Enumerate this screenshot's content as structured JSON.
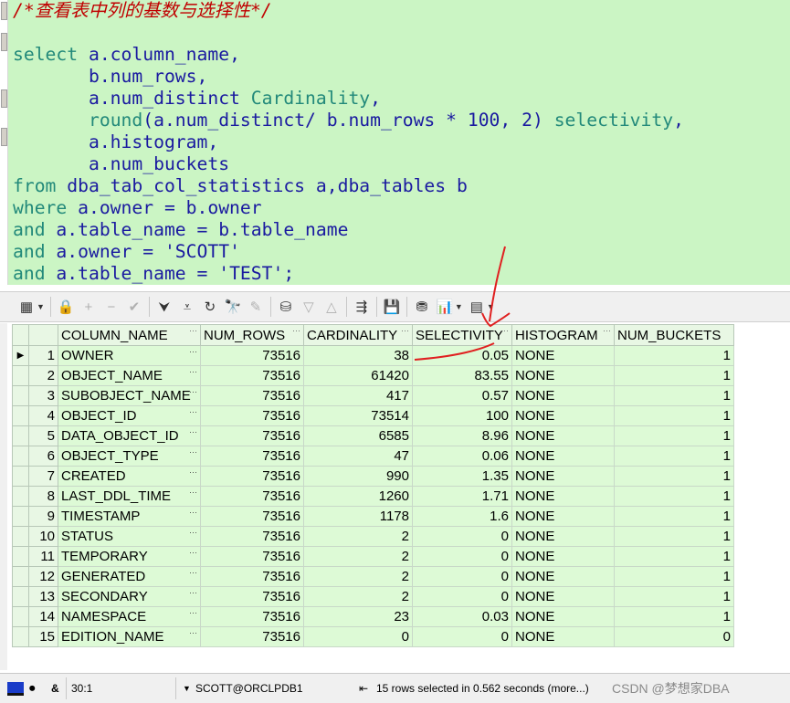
{
  "editor": {
    "lines": [
      [
        {
          "t": "/*查看表中列的基数与选择性*/",
          "c": "cmt"
        }
      ],
      [
        {
          "t": "",
          "c": ""
        }
      ],
      [
        {
          "t": "select",
          "c": "kw"
        },
        {
          "t": " a.column_name,",
          "c": ""
        }
      ],
      [
        {
          "t": "       b.num_rows,",
          "c": ""
        }
      ],
      [
        {
          "t": "       a.num_distinct ",
          "c": ""
        },
        {
          "t": "Cardinality",
          "c": "kw"
        },
        {
          "t": ",",
          "c": ""
        }
      ],
      [
        {
          "t": "       ",
          "c": ""
        },
        {
          "t": "round",
          "c": "kw"
        },
        {
          "t": "(a.num_distinct/ b.num_rows * ",
          "c": ""
        },
        {
          "t": "100",
          "c": "num"
        },
        {
          "t": ", ",
          "c": ""
        },
        {
          "t": "2",
          "c": "num"
        },
        {
          "t": ") ",
          "c": ""
        },
        {
          "t": "selectivity",
          "c": "kw"
        },
        {
          "t": ",",
          "c": ""
        }
      ],
      [
        {
          "t": "       a.histogram,",
          "c": ""
        }
      ],
      [
        {
          "t": "       a.num_buckets",
          "c": ""
        }
      ],
      [
        {
          "t": "from",
          "c": "kw"
        },
        {
          "t": " dba_tab_col_statistics a,dba_tables b",
          "c": ""
        }
      ],
      [
        {
          "t": "where",
          "c": "kw"
        },
        {
          "t": " a.owner = b.owner",
          "c": ""
        }
      ],
      [
        {
          "t": "and",
          "c": "kw"
        },
        {
          "t": " a.table_name = b.table_name",
          "c": ""
        }
      ],
      [
        {
          "t": "and",
          "c": "kw"
        },
        {
          "t": " a.owner = ",
          "c": ""
        },
        {
          "t": "'SCOTT'",
          "c": "str"
        }
      ],
      [
        {
          "t": "and",
          "c": "kw"
        },
        {
          "t": " a.table_name = ",
          "c": ""
        },
        {
          "t": "'TEST'",
          "c": "str"
        },
        {
          "t": ";",
          "c": ""
        }
      ]
    ]
  },
  "toolbar": {
    "icons": [
      {
        "name": "grid-columns-icon",
        "glyph": "▦",
        "dropdown": true,
        "enabled": true
      },
      {
        "sep": true
      },
      {
        "name": "lock-icon",
        "glyph": "🔒",
        "enabled": false
      },
      {
        "name": "add-record-icon",
        "glyph": "+",
        "enabled": false
      },
      {
        "name": "delete-record-icon",
        "glyph": "−",
        "enabled": false
      },
      {
        "name": "post-changes-icon",
        "glyph": "✔",
        "enabled": false
      },
      {
        "sep": true
      },
      {
        "name": "fetch-next-icon",
        "glyph": "⮟",
        "enabled": true
      },
      {
        "name": "fetch-last-icon",
        "glyph": "⩡",
        "enabled": true
      },
      {
        "name": "refresh-icon",
        "glyph": "↻",
        "enabled": true
      },
      {
        "name": "find-icon",
        "glyph": "🔭",
        "enabled": true
      },
      {
        "name": "clear-icon",
        "glyph": "✎",
        "enabled": false
      },
      {
        "sep": true
      },
      {
        "name": "query-by-example-icon",
        "glyph": "⛁",
        "enabled": true
      },
      {
        "name": "filter-down-icon",
        "glyph": "▽",
        "enabled": false
      },
      {
        "name": "filter-up-icon",
        "glyph": "△",
        "enabled": false
      },
      {
        "sep": true
      },
      {
        "name": "export-icon",
        "glyph": "⇶",
        "enabled": true
      },
      {
        "sep": true
      },
      {
        "name": "save-icon",
        "glyph": "💾",
        "enabled": true
      },
      {
        "sep": true
      },
      {
        "name": "database-icon",
        "glyph": "⛃",
        "enabled": true
      },
      {
        "name": "chart-icon",
        "glyph": "📊",
        "dropdown": true,
        "enabled": true
      },
      {
        "name": "table-export-icon",
        "glyph": "▤",
        "dropdown": true,
        "enabled": true
      }
    ]
  },
  "grid": {
    "columns": [
      "COLUMN_NAME",
      "NUM_ROWS",
      "CARDINALITY",
      "SELECTIVITY",
      "HISTOGRAM",
      "NUM_BUCKETS"
    ],
    "rows": [
      [
        "1",
        "OWNER",
        "73516",
        "38",
        "0.05",
        "NONE",
        "1"
      ],
      [
        "2",
        "OBJECT_NAME",
        "73516",
        "61420",
        "83.55",
        "NONE",
        "1"
      ],
      [
        "3",
        "SUBOBJECT_NAME",
        "73516",
        "417",
        "0.57",
        "NONE",
        "1"
      ],
      [
        "4",
        "OBJECT_ID",
        "73516",
        "73514",
        "100",
        "NONE",
        "1"
      ],
      [
        "5",
        "DATA_OBJECT_ID",
        "73516",
        "6585",
        "8.96",
        "NONE",
        "1"
      ],
      [
        "6",
        "OBJECT_TYPE",
        "73516",
        "47",
        "0.06",
        "NONE",
        "1"
      ],
      [
        "7",
        "CREATED",
        "73516",
        "990",
        "1.35",
        "NONE",
        "1"
      ],
      [
        "8",
        "LAST_DDL_TIME",
        "73516",
        "1260",
        "1.71",
        "NONE",
        "1"
      ],
      [
        "9",
        "TIMESTAMP",
        "73516",
        "1178",
        "1.6",
        "NONE",
        "1"
      ],
      [
        "10",
        "STATUS",
        "73516",
        "2",
        "0",
        "NONE",
        "1"
      ],
      [
        "11",
        "TEMPORARY",
        "73516",
        "2",
        "0",
        "NONE",
        "1"
      ],
      [
        "12",
        "GENERATED",
        "73516",
        "2",
        "0",
        "NONE",
        "1"
      ],
      [
        "13",
        "SECONDARY",
        "73516",
        "2",
        "0",
        "NONE",
        "1"
      ],
      [
        "14",
        "NAMESPACE",
        "73516",
        "23",
        "0.03",
        "NONE",
        "1"
      ],
      [
        "15",
        "EDITION_NAME",
        "73516",
        "0",
        "0",
        "NONE",
        "0"
      ]
    ],
    "cell_dots": "···",
    "current_row_marker": "▶"
  },
  "statusbar": {
    "ampersand": "&",
    "cursor_pos": "30:1",
    "connection_marker": "▼",
    "connection": "SCOTT@ORCLPDB1",
    "rows_selected": "15 rows selected in 0.562 seconds (more...)",
    "watermark": "CSDN @梦想家DBA"
  },
  "colors": {
    "editor_bg": "#cbf5c4",
    "grid_row_bg": "#ddfad6",
    "annotation": "#e02020"
  }
}
